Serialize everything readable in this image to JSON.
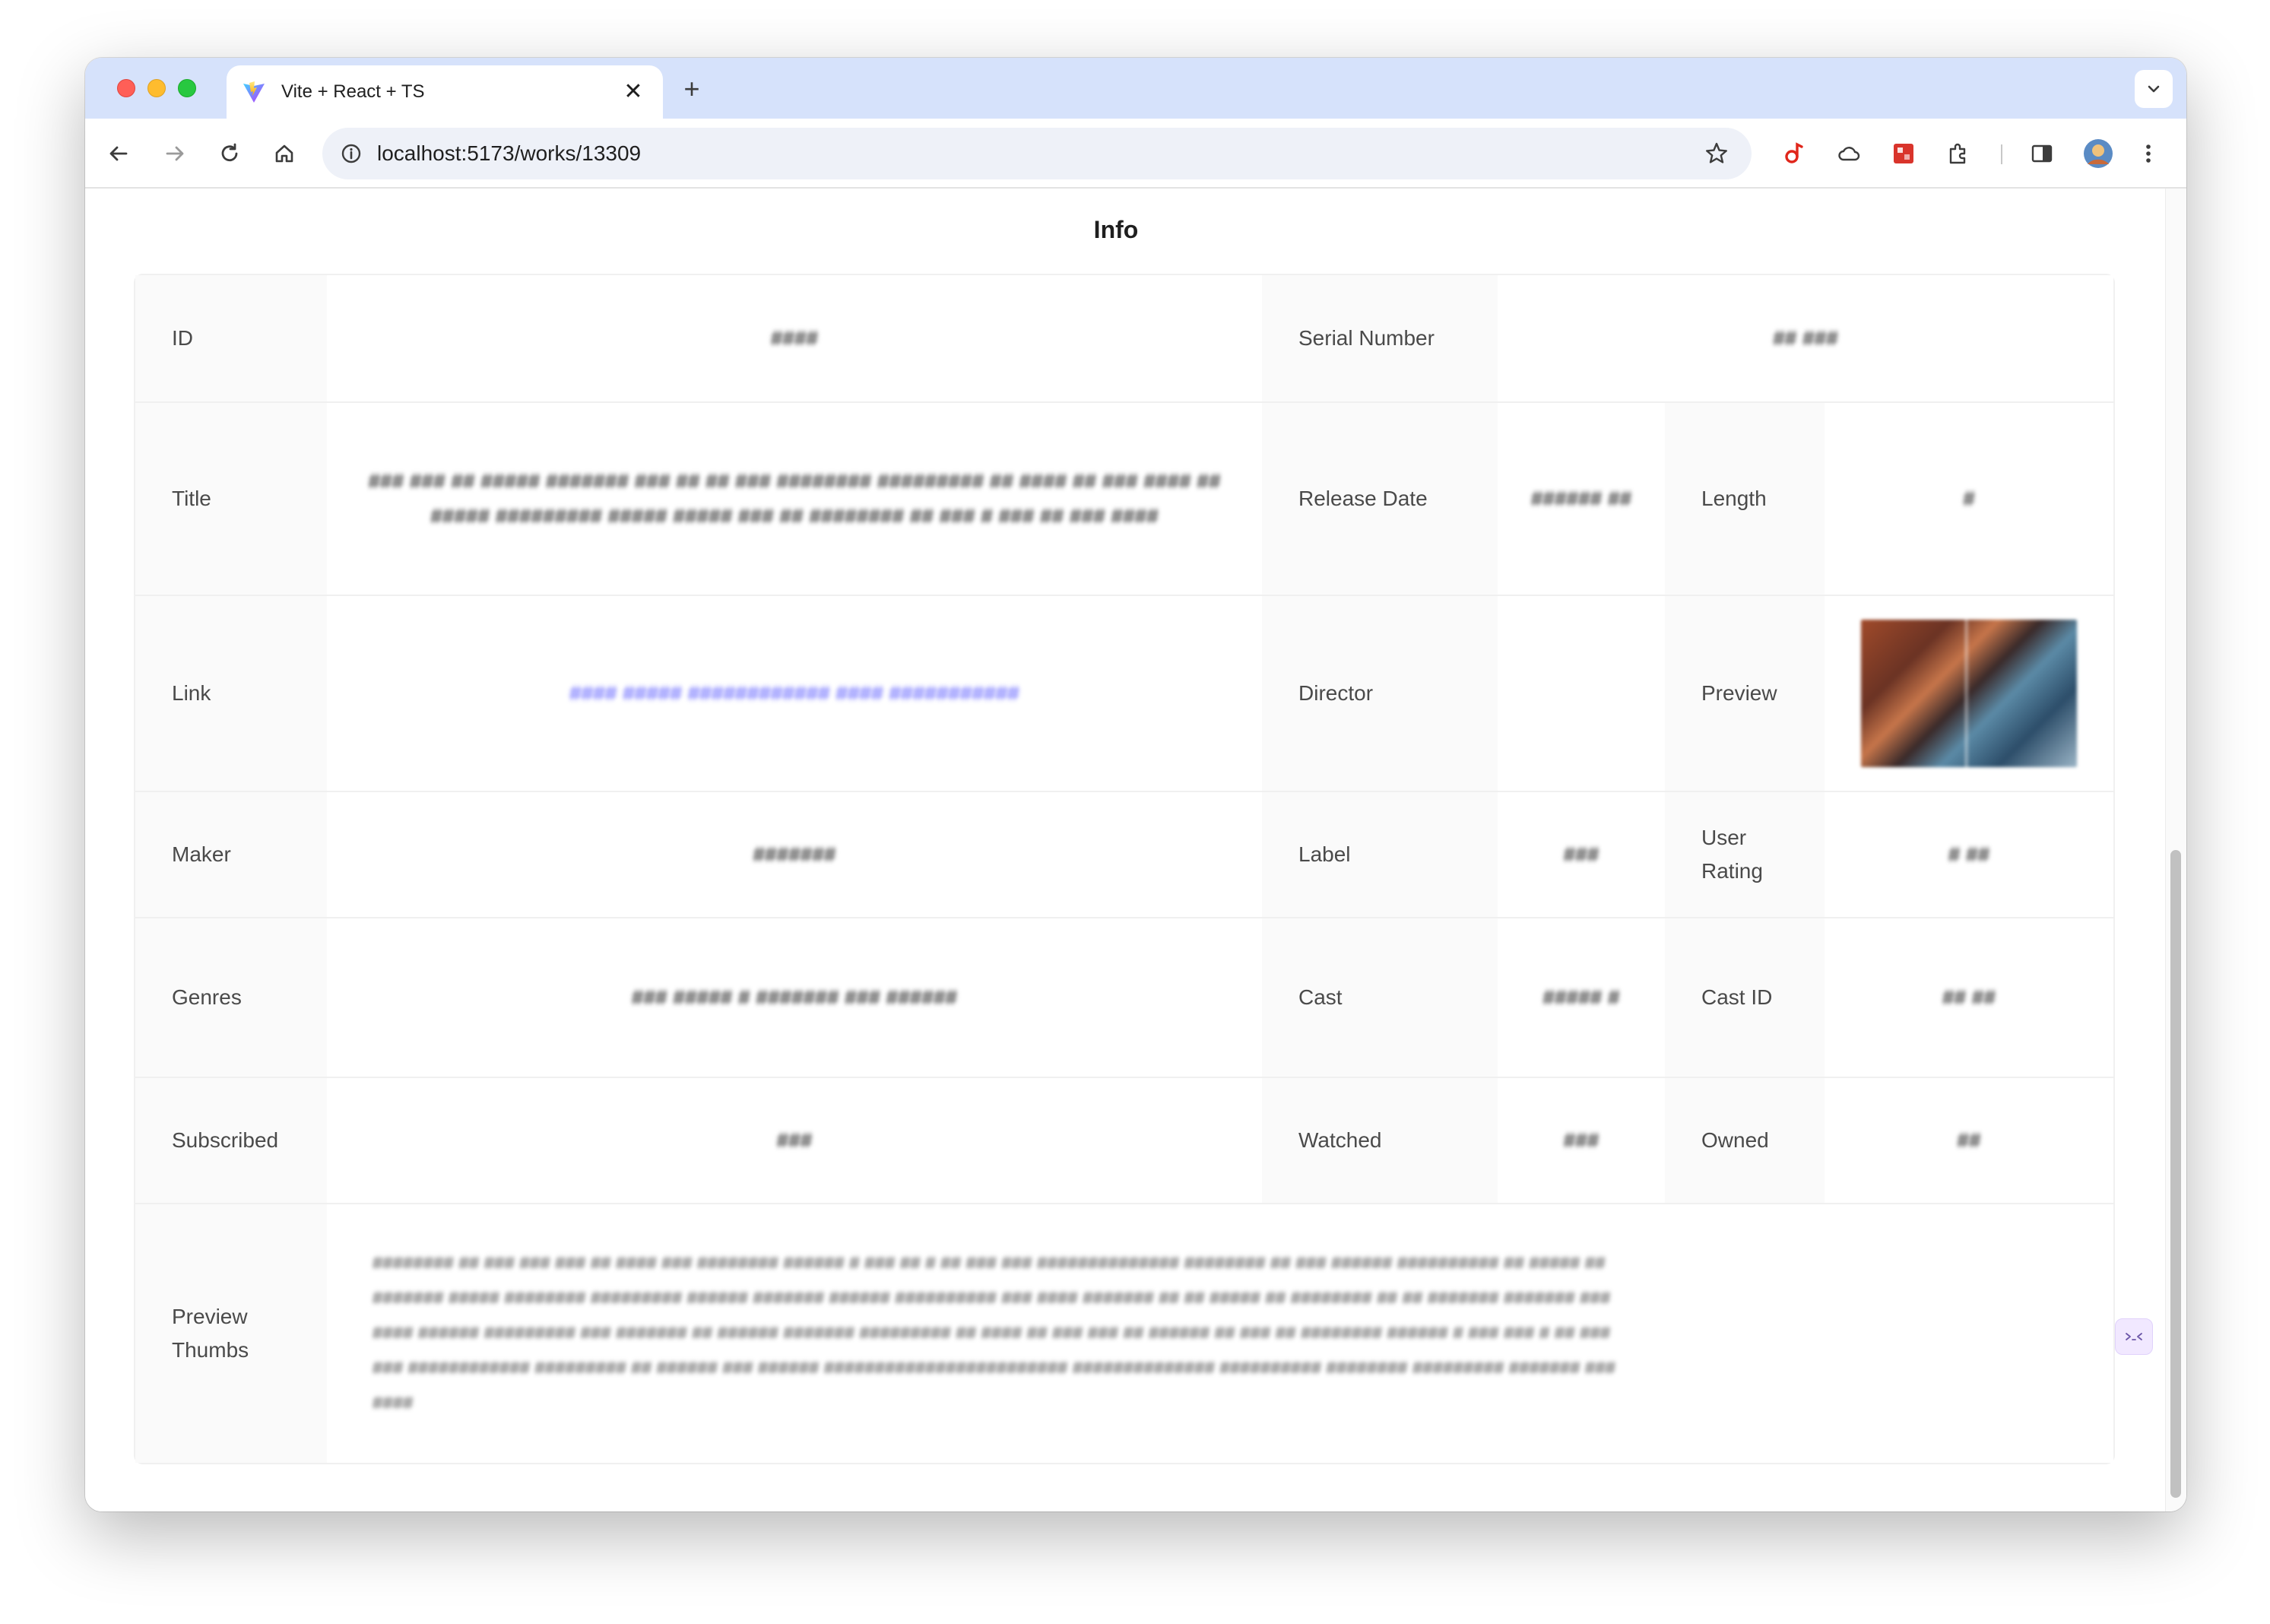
{
  "browser": {
    "tab_title": "Vite + React + TS",
    "tab_close": "✕",
    "new_tab": "+",
    "url": "localhost:5173/works/13309",
    "accent_color": "#d6e2fb"
  },
  "page": {
    "heading": "Info"
  },
  "info": {
    "id_label": "ID",
    "id_value": "####",
    "serial_label": "Serial Number",
    "serial_value": "## ###",
    "title_label": "Title",
    "title_value": "### ### ## ##### ####### ### ## ## ### ######## ######### ## #### ## ### #### ## ##### ######### ##### ##### ### ## ######## ## ### # ### ## ### ####",
    "release_label": "Release Date",
    "release_value": "###### ##",
    "length_label": "Length",
    "length_value": "#",
    "link_label": "Link",
    "link_value": "#### ##### ############ #### ###########",
    "director_label": "Director",
    "director_value": "",
    "preview_label": "Preview",
    "maker_label": "Maker",
    "maker_value": "#######",
    "label_label": "Label",
    "label_value": "###",
    "user_rating_label": "User Rating",
    "user_rating_value": "# ##",
    "genres_label": "Genres",
    "genres_value": "### ##### # ####### ### ######",
    "cast_label": "Cast",
    "cast_value": "##### #",
    "cast_id_label": "Cast ID",
    "cast_id_value": "## ##",
    "subscribed_label": "Subscribed",
    "subscribed_value": "###",
    "watched_label": "Watched",
    "watched_value": "###",
    "owned_label": "Owned",
    "owned_value": "##",
    "thumbs_label": "Preview Thumbs",
    "thumbs_value": "######## ## ### ### ### ## #### ### ######## ###### # ### ## # ## ### ### ############## ######## ## ### ###### ########## ## ##### ## ####### ##### ######## ######### ###### ####### ###### ########## ### #### ####### ## ## ##### ## ######## ## ## ####### ####### ####### ###### ######### ### ####### ## ###### ####### ######### ## #### ## ### ### ## ###### ## ### ## ######## ###### # ### ### # ## ### ### ############ ######### ## ###### ### ###### ######################## ############## ########## ######## ######### ####### #######"
  }
}
